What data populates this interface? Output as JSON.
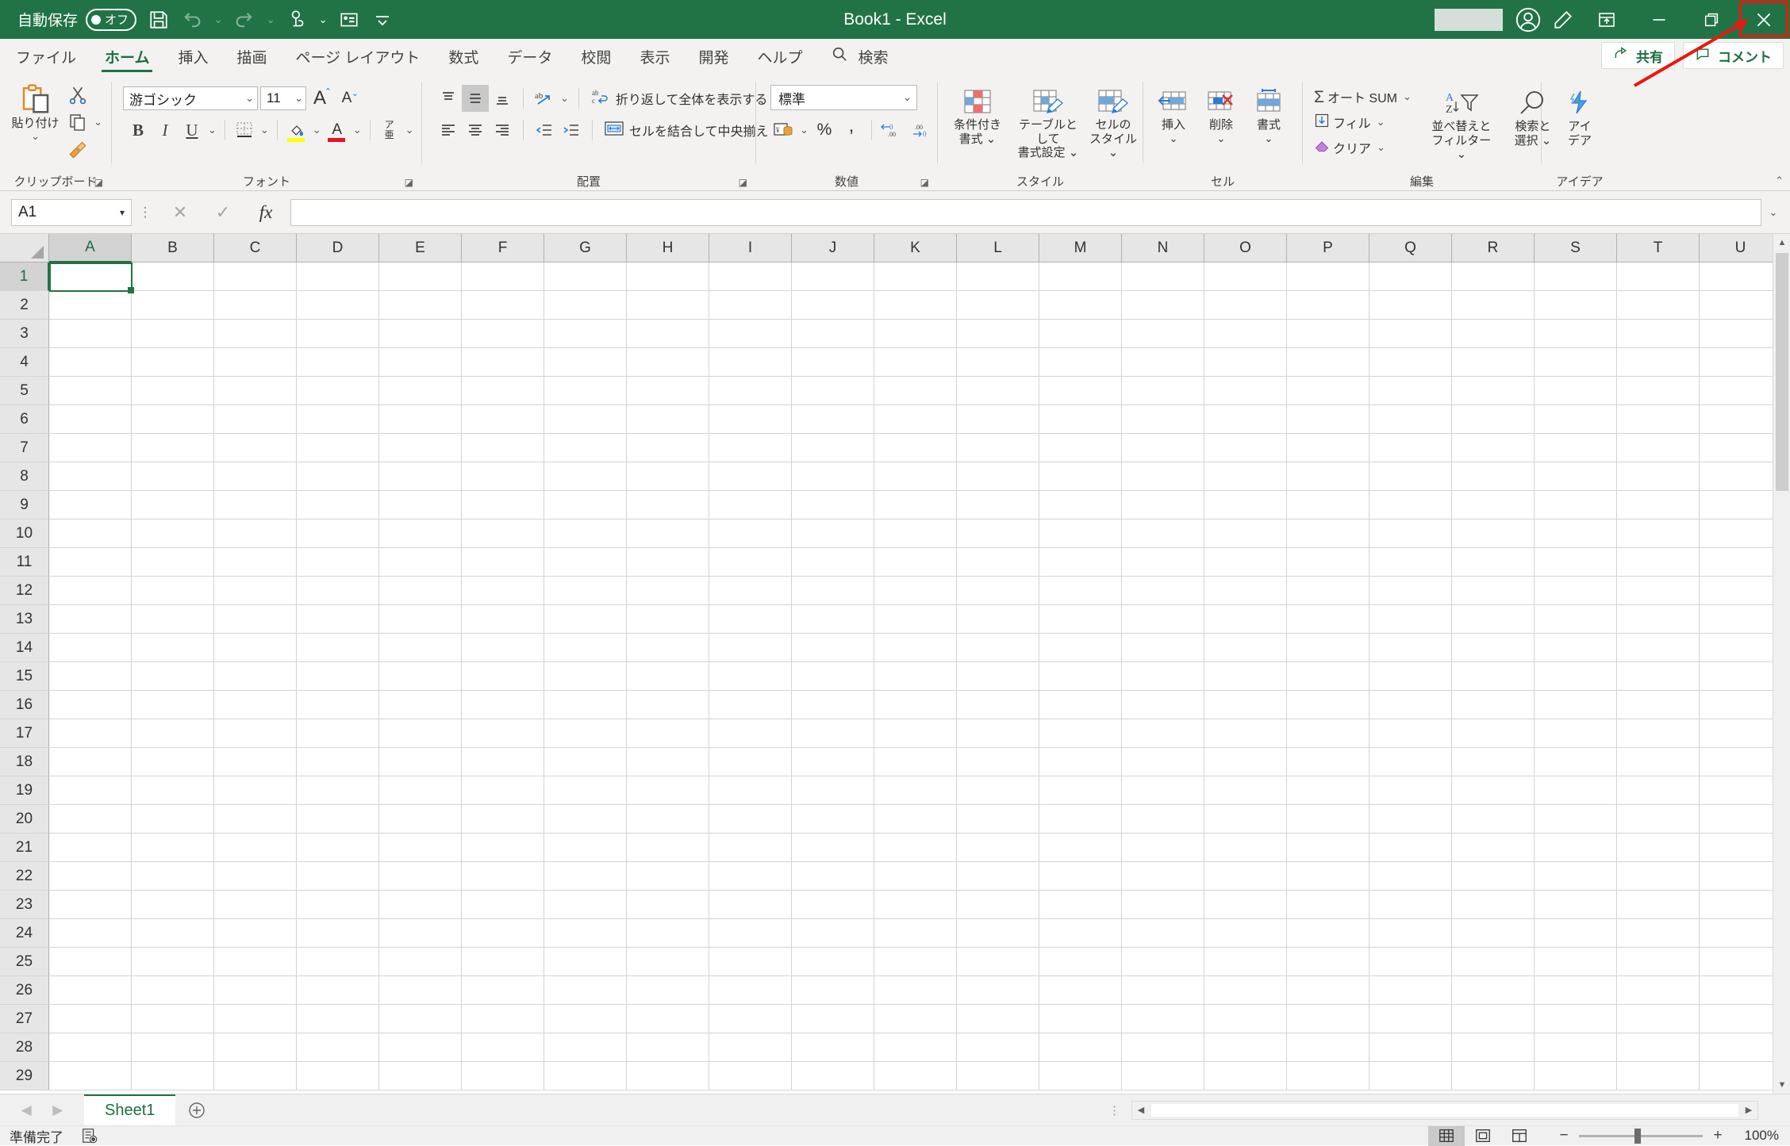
{
  "titlebar": {
    "autosave_label": "自動保存",
    "autosave_state": "オフ",
    "title": "Book1  -  Excel",
    "quick_access": [
      {
        "name": "save-icon",
        "label": "保存"
      },
      {
        "name": "undo-icon",
        "label": "元に戻す"
      },
      {
        "name": "redo-icon",
        "label": "やり直し"
      },
      {
        "name": "touch-mode-icon",
        "label": "タッチ/マウス モードの切り替え"
      },
      {
        "name": "quick-print-icon",
        "label": "クイック印刷"
      },
      {
        "name": "customize-qat-icon",
        "label": "クイック アクセス ツール バーのユーザー設定"
      }
    ],
    "window_buttons": [
      {
        "name": "ribbon-display-options",
        "glyph": "▣"
      },
      {
        "name": "minimize-button",
        "glyph": "—"
      },
      {
        "name": "restore-button",
        "glyph": "❐"
      },
      {
        "name": "close-button",
        "glyph": "✕"
      }
    ],
    "highlight_color": "#e8190f"
  },
  "tabs": [
    {
      "label": "ファイル",
      "active": false
    },
    {
      "label": "ホーム",
      "active": true
    },
    {
      "label": "挿入",
      "active": false
    },
    {
      "label": "描画",
      "active": false
    },
    {
      "label": "ページ レイアウト",
      "active": false
    },
    {
      "label": "数式",
      "active": false
    },
    {
      "label": "データ",
      "active": false
    },
    {
      "label": "校閲",
      "active": false
    },
    {
      "label": "表示",
      "active": false
    },
    {
      "label": "開発",
      "active": false
    },
    {
      "label": "ヘルプ",
      "active": false
    }
  ],
  "search": {
    "label": "検索",
    "placeholder": "検索"
  },
  "tab_right": {
    "share_label": "共有",
    "comments_label": "コメント"
  },
  "ribbon": {
    "clipboard": {
      "group_label": "クリップボード",
      "paste_label": "貼り付け",
      "cut_label": "切り取り",
      "copy_label": "コピー",
      "format_painter_label": "書式のコピー/貼り付け"
    },
    "font": {
      "group_label": "フォント",
      "font_name": "游ゴシック",
      "font_size": "11",
      "grow_label": "A",
      "shrink_label": "A",
      "bold_label": "B",
      "italic_label": "I",
      "underline_label": "U",
      "border_label": "罫線",
      "fill_color_label": "塗りつぶしの色",
      "font_color_label": "A",
      "phonetic_label": "ア\n亜"
    },
    "alignment": {
      "group_label": "配置",
      "wrap_text_label": "折り返して全体を表示する",
      "merge_center_label": "セルを結合して中央揃え",
      "orientation_label": "ab"
    },
    "number": {
      "group_label": "数値",
      "format_value": "標準",
      "percent_label": "%",
      "comma_label": ",",
      "increase_decimal_label": ".00",
      "decrease_decimal_label": ".00"
    },
    "styles": {
      "group_label": "スタイル",
      "conditional_label": "条件付き\n書式",
      "table_label": "テーブルとして\n書式設定",
      "cellstyle_label": "セルの\nスタイル"
    },
    "cells": {
      "group_label": "セル",
      "insert_label": "挿入",
      "delete_label": "削除",
      "format_label": "書式"
    },
    "editing": {
      "group_label": "編集",
      "autosum_label": "オート SUM",
      "fill_label": "フィル",
      "clear_label": "クリア",
      "sort_filter_label": "並べ替えと\nフィルター",
      "find_select_label": "検索と\n選択"
    },
    "ideas": {
      "group_label": "アイデア",
      "ideas_label": "アイ\nデア"
    }
  },
  "formula_bar": {
    "name_box_value": "A1",
    "cancel_label": "✕",
    "enter_label": "✓",
    "fx_label": "fx",
    "formula_value": "",
    "expand_label": "⌄"
  },
  "grid": {
    "columns": [
      "A",
      "B",
      "C",
      "D",
      "E",
      "F",
      "G",
      "H",
      "I",
      "J",
      "K",
      "L",
      "M",
      "N",
      "O",
      "P",
      "Q",
      "R",
      "S",
      "T",
      "U"
    ],
    "rows": [
      "1",
      "2",
      "3",
      "4",
      "5",
      "6",
      "7",
      "8",
      "9",
      "10",
      "11",
      "12",
      "13",
      "14",
      "15",
      "16",
      "17",
      "18",
      "19",
      "20",
      "21",
      "22",
      "23",
      "24",
      "25",
      "26",
      "27",
      "28",
      "29"
    ],
    "active_cell": "A1",
    "selection_color": "#217346"
  },
  "sheet_bar": {
    "sheets": [
      {
        "label": "Sheet1",
        "active": true
      }
    ],
    "add_sheet_label": "+",
    "prev_label": "◀",
    "next_label": "▶"
  },
  "status_bar": {
    "status_text": "準備完了",
    "accessibility_label": "アクセシビリティ: 検討が必要です",
    "views": [
      {
        "name": "normal-view-button",
        "active": true
      },
      {
        "name": "page-layout-view-button",
        "active": false
      },
      {
        "name": "page-break-preview-button",
        "active": false
      }
    ],
    "zoom_out_label": "−",
    "zoom_in_label": "+",
    "zoom_level": "100%"
  }
}
